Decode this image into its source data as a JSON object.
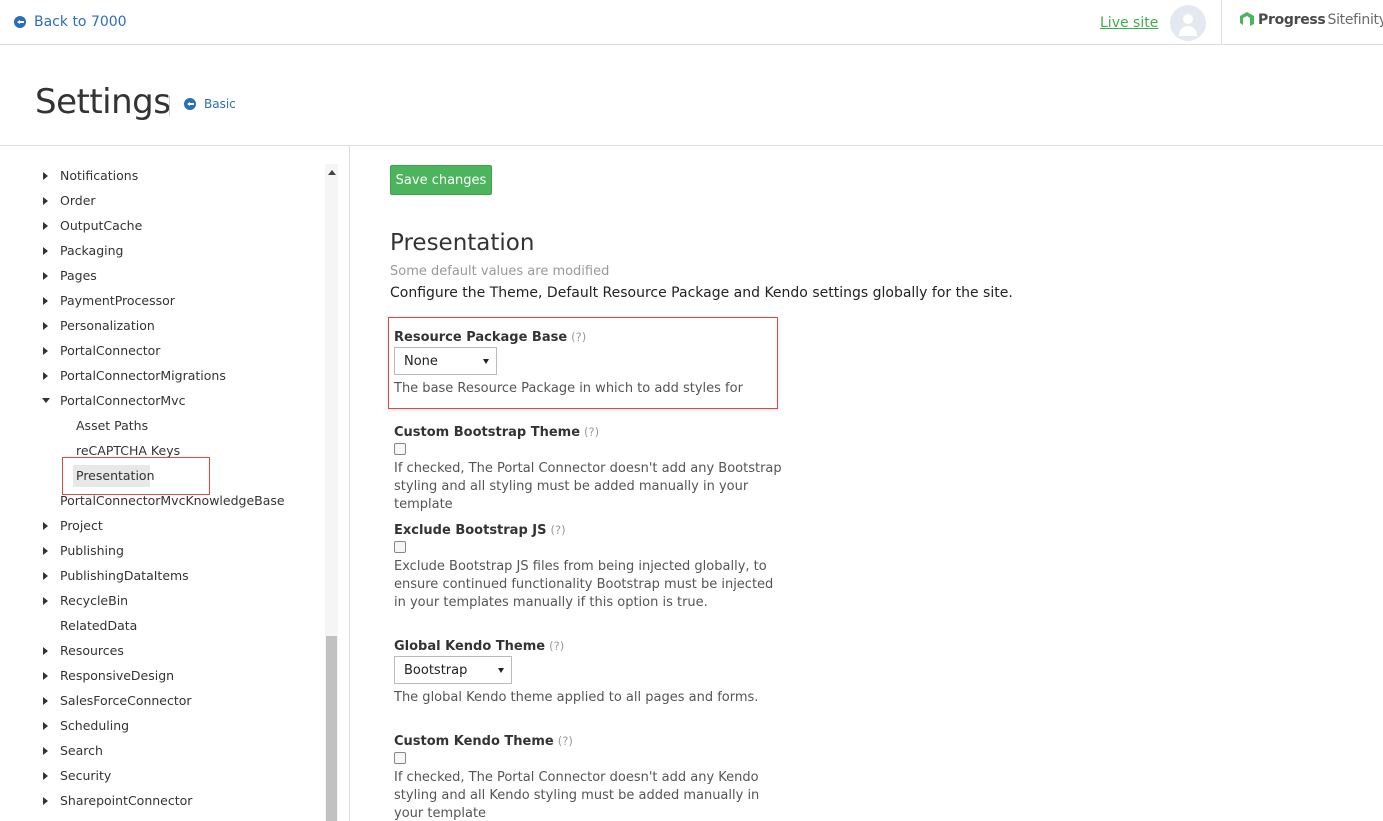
{
  "topbar": {
    "back_label": "Back to 7000",
    "live_site_label": "Live site",
    "logo_progress": "Progress",
    "logo_sitefinity": "Sitefinity",
    "logo_tm": "™",
    "brand_color": "#4cb45c"
  },
  "header": {
    "title": "Settings",
    "basic_label": "Basic"
  },
  "sidebar": {
    "items": [
      {
        "label": "Notifications",
        "expander": "collapsed"
      },
      {
        "label": "Order",
        "expander": "collapsed"
      },
      {
        "label": "OutputCache",
        "expander": "collapsed"
      },
      {
        "label": "Packaging",
        "expander": "collapsed"
      },
      {
        "label": "Pages",
        "expander": "collapsed"
      },
      {
        "label": "PaymentProcessor",
        "expander": "collapsed"
      },
      {
        "label": "Personalization",
        "expander": "collapsed"
      },
      {
        "label": "PortalConnector",
        "expander": "collapsed"
      },
      {
        "label": "PortalConnectorMigrations",
        "expander": "collapsed"
      },
      {
        "label": "PortalConnectorMvc",
        "expander": "expanded"
      },
      {
        "label": "Asset Paths",
        "expander": "none",
        "child": true
      },
      {
        "label": "reCAPTCHA Keys",
        "expander": "none",
        "child": true
      },
      {
        "label": "Presentation",
        "expander": "none",
        "child": true,
        "selected": true
      },
      {
        "label": "PortalConnectorMvcKnowledgeBase",
        "expander": "none"
      },
      {
        "label": "Project",
        "expander": "collapsed"
      },
      {
        "label": "Publishing",
        "expander": "collapsed"
      },
      {
        "label": "PublishingDataItems",
        "expander": "collapsed"
      },
      {
        "label": "RecycleBin",
        "expander": "collapsed"
      },
      {
        "label": "RelatedData",
        "expander": "none"
      },
      {
        "label": "Resources",
        "expander": "collapsed"
      },
      {
        "label": "ResponsiveDesign",
        "expander": "collapsed"
      },
      {
        "label": "SalesForceConnector",
        "expander": "collapsed"
      },
      {
        "label": "Scheduling",
        "expander": "collapsed"
      },
      {
        "label": "Search",
        "expander": "collapsed"
      },
      {
        "label": "Security",
        "expander": "collapsed"
      },
      {
        "label": "SharepointConnector",
        "expander": "collapsed"
      }
    ]
  },
  "main": {
    "save_label": "Save changes",
    "section_title": "Presentation",
    "modified_note": "Some default values are modified",
    "section_description": "Configure the Theme, Default Resource Package and Kendo settings globally for the site.",
    "help_marker": "(?)",
    "fields": {
      "resource_package": {
        "label": "Resource Package Base",
        "value": "None",
        "help": "The base Resource Package in which to add styles for"
      },
      "custom_bootstrap": {
        "label": "Custom Bootstrap Theme",
        "checked": false,
        "help": "If checked, The Portal Connector doesn't add any Bootstrap styling and all styling must be added manually in your template"
      },
      "exclude_bootstrap_js": {
        "label": "Exclude Bootstrap JS",
        "checked": false,
        "help": "Exclude Bootstrap JS files from being injected globally, to ensure continued functionality Bootstrap must be injected in your templates manually if this option is true."
      },
      "global_kendo": {
        "label": "Global Kendo Theme",
        "value": "Bootstrap",
        "help": "The global Kendo theme applied to all pages and forms."
      },
      "custom_kendo": {
        "label": "Custom Kendo Theme",
        "checked": false,
        "help": "If checked, The Portal Connector doesn't add any Kendo styling and all Kendo styling must be added manually in your template"
      }
    }
  }
}
